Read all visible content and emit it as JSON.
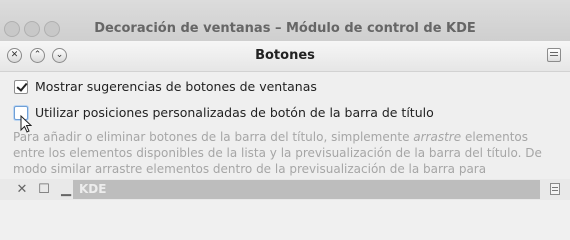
{
  "background_window": {
    "title": "Decoración de ventanas – Módulo de control de KDE"
  },
  "dialog": {
    "title": "Botones",
    "options": [
      {
        "label": "Mostrar sugerencias de botones de ventanas",
        "checked": true
      },
      {
        "label": "Utilizar posiciones personalizadas de botón de la barra de título",
        "checked": false
      }
    ],
    "description": "Para añadir o eliminar botones de la barra del título, simplemente arrastre elementos entre los elementos disponibles de la lista y la previsualización de la barra del título. De modo similar arrastre elementos dentro de la previsualización de la barra para reposicionarlos.",
    "description_parts": {
      "before": "Para añadir o eliminar botones de la barra del título, simplemente ",
      "emphasis": "arrastre",
      "after": " elementos entre los elementos disponibles de la lista y la previsualización de la barra del título. De modo similar arrastre elementos dentro de la previsualización de la barra para reposicionarlos."
    },
    "preview": {
      "buttons": [
        "close-icon",
        "maximize-icon",
        "minimize-icon"
      ],
      "title": "KDE",
      "menu_icon": "menu-icon"
    }
  }
}
